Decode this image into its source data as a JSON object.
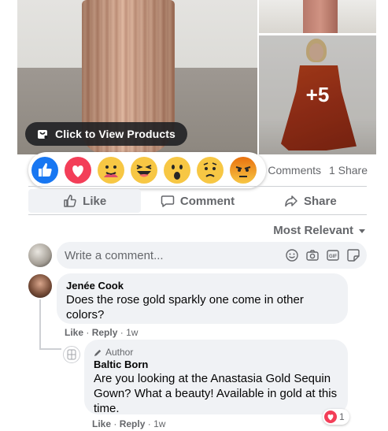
{
  "photos": {
    "cta_label": "Click to View Products",
    "more_count": "+5"
  },
  "reactions_bar": [
    "like",
    "love",
    "care",
    "haha",
    "wow",
    "sad",
    "angry"
  ],
  "post_stats": {
    "comments": "Comments",
    "shares": "1 Share"
  },
  "actions": {
    "like": "Like",
    "comment": "Comment",
    "share": "Share"
  },
  "sort": {
    "label": "Most Relevant"
  },
  "composer": {
    "placeholder": "Write a comment..."
  },
  "comments": [
    {
      "name": "Jenée Cook",
      "text": "Does the rose gold sparkly one come in other colors?",
      "like": "Like",
      "reply": "Reply",
      "time": "1w"
    }
  ],
  "reply": {
    "badge": "Author",
    "name": "Baltic Born",
    "text": "Are you looking at the Anastasia Gold Sequin Gown? What a beauty! Available in gold at this time.",
    "like": "Like",
    "reply": "Reply",
    "time": "1w",
    "reaction_count": "1"
  },
  "colors": {
    "facebook_blue": "#1877f2",
    "secondary_text": "#65676b",
    "bubble_bg": "#f0f2f5",
    "love_red": "#f33e58"
  }
}
